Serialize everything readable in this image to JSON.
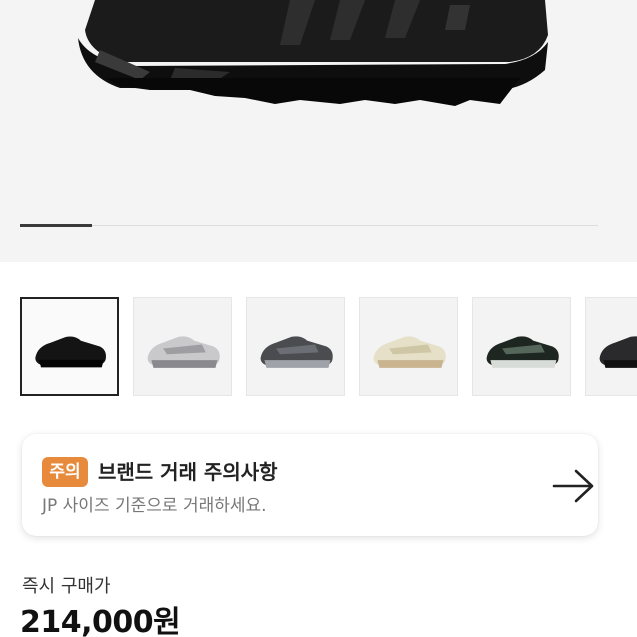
{
  "product": {
    "gallery": {
      "progress_fraction": 0.125,
      "thumbnails": [
        {
          "colorway": "black",
          "selected": true
        },
        {
          "colorway": "silver",
          "selected": false
        },
        {
          "colorway": "grey",
          "selected": false
        },
        {
          "colorway": "cream",
          "selected": false
        },
        {
          "colorway": "black-green",
          "selected": false
        },
        {
          "colorway": "black-grey",
          "selected": false
        }
      ]
    },
    "notice": {
      "badge": "주의",
      "title": "브랜드 거래 주의사항",
      "description": "JP 사이즈 기준으로 거래하세요.",
      "arrow_icon": "arrow-right-icon",
      "badge_color": "#e88a3c"
    },
    "price": {
      "label": "즉시 구매가",
      "value": "214,000원"
    }
  }
}
